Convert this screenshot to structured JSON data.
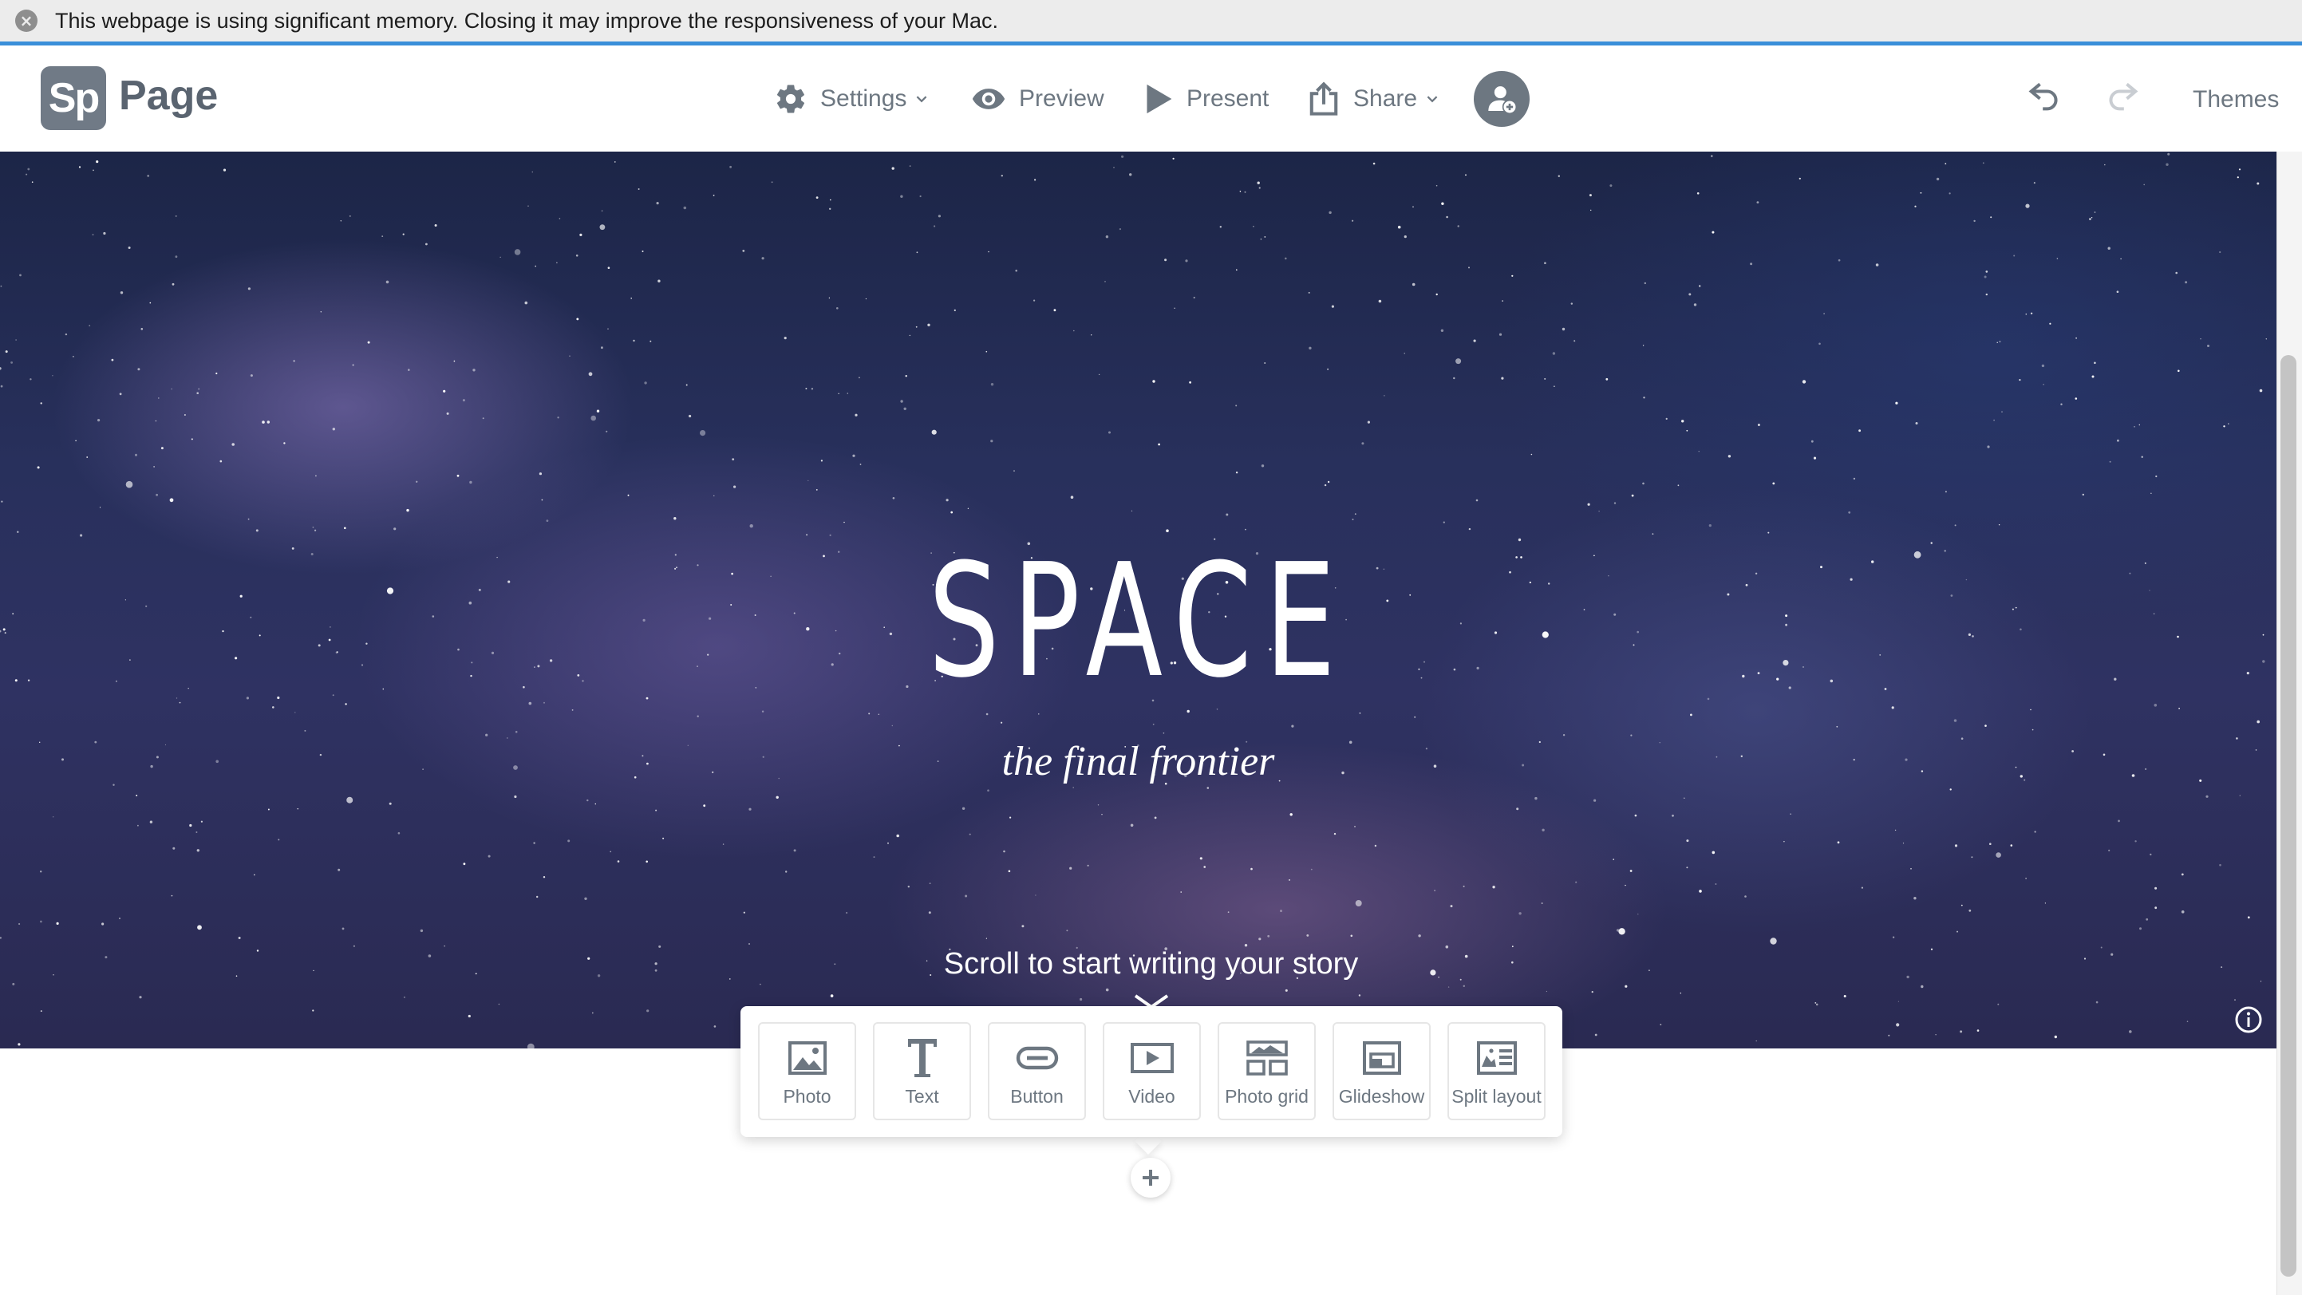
{
  "banner": {
    "text": "This webpage is using significant memory. Closing it may improve the responsiveness of your Mac.",
    "close_icon": "close-icon"
  },
  "app": {
    "logo_mark": "Sp",
    "logo_text": "Page"
  },
  "toolbar": {
    "settings_label": "Settings",
    "preview_label": "Preview",
    "present_label": "Present",
    "share_label": "Share",
    "themes_label": "Themes"
  },
  "hero": {
    "title": "SPACE",
    "subtitle": "the final frontier",
    "scroll_hint": "Scroll to start writing your story"
  },
  "insert_menu": {
    "items": [
      {
        "label": "Photo",
        "icon": "photo-icon"
      },
      {
        "label": "Text",
        "icon": "text-icon"
      },
      {
        "label": "Button",
        "icon": "button-icon"
      },
      {
        "label": "Video",
        "icon": "video-icon"
      },
      {
        "label": "Photo grid",
        "icon": "photo-grid-icon"
      },
      {
        "label": "Glideshow",
        "icon": "glideshow-icon"
      },
      {
        "label": "Split layout",
        "icon": "split-layout-icon"
      }
    ]
  },
  "colors": {
    "accent_blue": "#3a8fd9",
    "toolbar_grey": "#6d7781",
    "logo_bg": "#707a86"
  }
}
